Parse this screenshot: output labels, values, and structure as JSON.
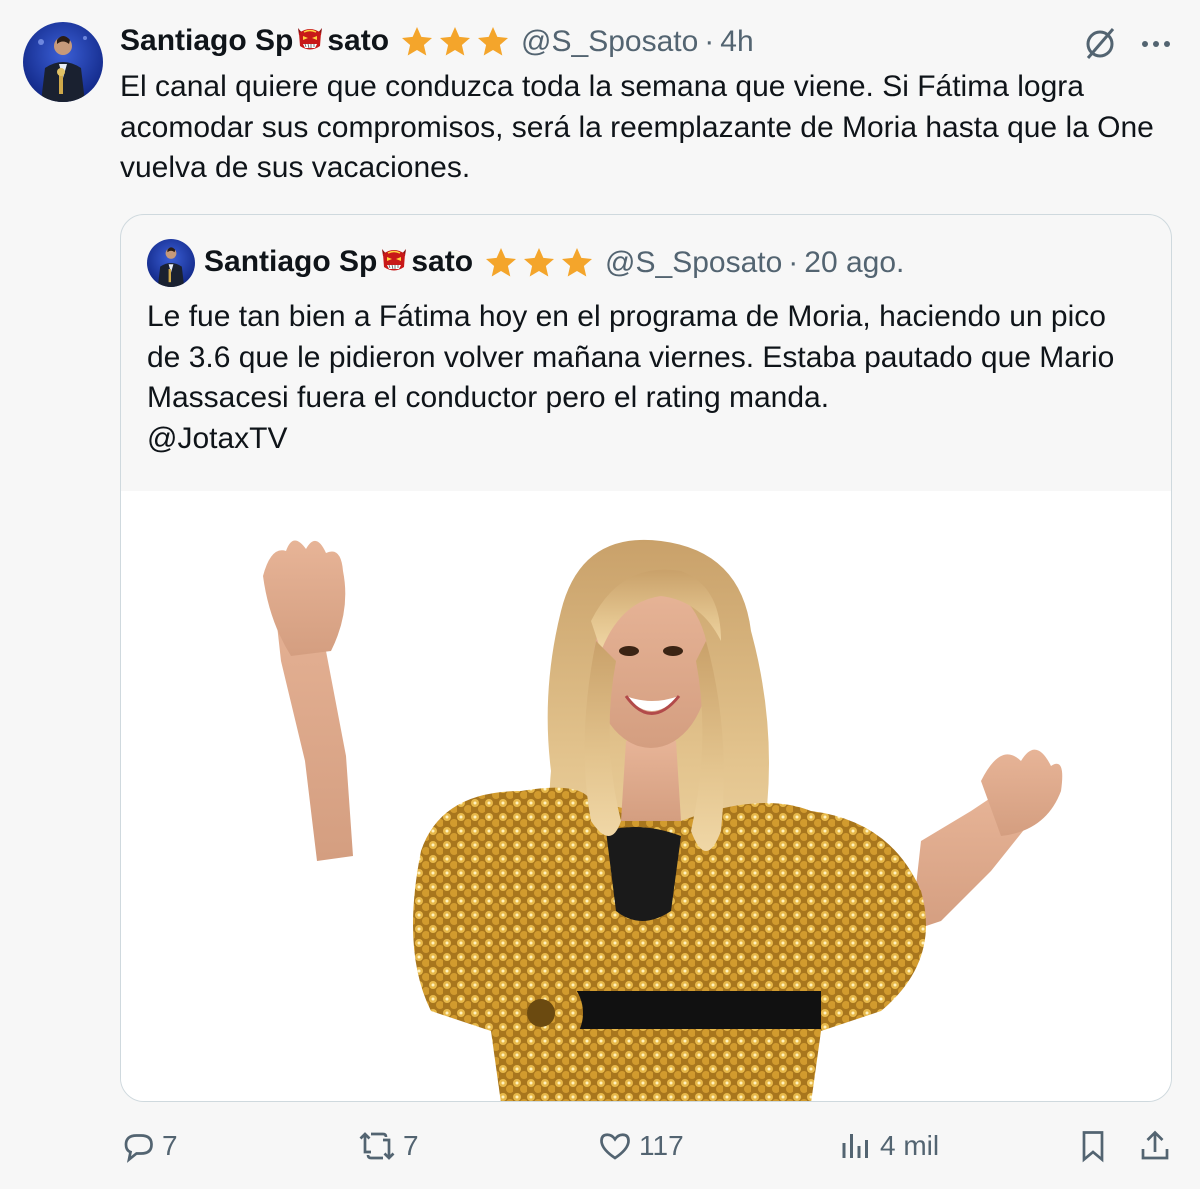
{
  "tweet": {
    "author_name_start": "Santiago Sp",
    "author_name_end": "sato",
    "handle": "@S_Sposato",
    "separator": "·",
    "time": "4h",
    "text": "El canal quiere que conduzca toda la semana que viene. Si Fátima logra acomodar sus compromisos, será la reemplazante de Moria hasta que la One vuelva de sus vacaciones."
  },
  "quoted": {
    "author_name_start": "Santiago Sp",
    "author_name_end": "sato",
    "handle": "@S_Sposato",
    "separator": "·",
    "time": "20 ago.",
    "text_line1": "Le fue tan bien a Fátima hoy en el programa de Moria, haciendo un pico de 3.6 que le pidieron volver mañana viernes. Estaba pautado que Mario Massacesi fuera el conductor pero el rating manda.",
    "mention": "@JotaxTV"
  },
  "actions": {
    "replies": "7",
    "reposts": "7",
    "likes": "117",
    "views": "4 mil"
  },
  "colors": {
    "star": "#f4a52b",
    "muted": "#536471",
    "text": "#0f1419",
    "border": "#cfd9de"
  },
  "icons": [
    "grok-icon",
    "more-icon",
    "reply-icon",
    "repost-icon",
    "like-icon",
    "views-icon",
    "bookmark-icon",
    "share-icon",
    "star-icon",
    "devil-mask-emoji"
  ]
}
